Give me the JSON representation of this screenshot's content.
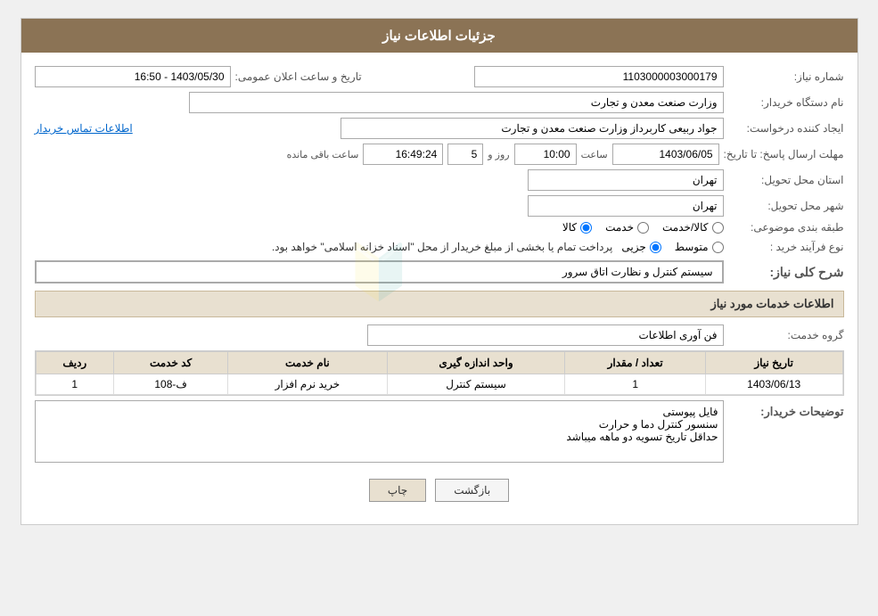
{
  "header": {
    "title": "جزئیات اطلاعات نیاز"
  },
  "form": {
    "labels": {
      "shomara_niaz": "شماره نیاز:",
      "nam_dastgah": "نام دستگاه خریدار:",
      "ijad_konande": "ایجاد کننده درخواست:",
      "mohlat_ersal": "مهلت ارسال پاسخ: تا تاریخ:",
      "ostan_mahall": "استان محل تحویل:",
      "shahr_mahall": "شهر محل تحویل:",
      "tabaqe_bandi": "طبقه بندی موضوعی:",
      "noe_farayand": "نوع فرآیند خرید :"
    },
    "shomara_niaz_value": "1103000003000179",
    "tarikh_value": "1403/05/30 - 16:50",
    "tarikh_label": "تاریخ و ساعت اعلان عمومی:",
    "nam_dastgah_value": "وزارت صنعت معدن و تجارت",
    "ijad_konande_value": "جواد ربیعی کاربرداز وزارت صنعت معدن و تجارت",
    "ettelaat_tamas": "اطلاعات تماس خریدار",
    "mohlat_date": "1403/06/05",
    "mohlat_saat_label": "ساعت",
    "mohlat_saat_value": "10:00",
    "mohlat_roz_label": "روز و",
    "mohlat_roz_value": "5",
    "mohlat_baqi_label": "ساعت باقی مانده",
    "mohlat_baqi_value": "16:49:24",
    "ostan_value": "تهران",
    "shahr_value": "تهران",
    "tabaqe_options": [
      "کالا",
      "خدمت",
      "کالا/خدمت"
    ],
    "tabaqe_selected": "کالا",
    "noe_farayand_options": [
      "جزیی",
      "متوسط"
    ],
    "noe_farayand_note": "پرداخت تمام یا بخشی از مبلغ خریدار از محل \"اسناد خزانه اسلامی\" خواهد بود.",
    "sharh_koli_label": "شرح کلی نیاز:",
    "sharh_koli_value": "سیستم کنترل و نظارت اتاق سرور",
    "service_section_header": "اطلاعات خدمات مورد نیاز",
    "goroh_khedmat_label": "گروه خدمت:",
    "goroh_khedmat_value": "فن آوری اطلاعات",
    "table": {
      "headers": [
        "ردیف",
        "کد خدمت",
        "نام خدمت",
        "واحد اندازه گیری",
        "تعداد / مقدار",
        "تاریخ نیاز"
      ],
      "rows": [
        {
          "radif": "1",
          "kod_khedmat": "ف-108",
          "nam_khedmat": "خرید نرم افزار",
          "vahed": "سیستم کنترل",
          "tedad": "1",
          "tarikh_niaz": "1403/06/13"
        }
      ]
    },
    "tozihat_label": "توضیحات خریدار:",
    "tozihat_value": "فایل پیوستی\nسنسور کنترل دما و حرارت\nحداقل تاریخ تسویه دو ماهه میباشد",
    "buttons": {
      "print": "چاپ",
      "back": "بازگشت"
    }
  }
}
